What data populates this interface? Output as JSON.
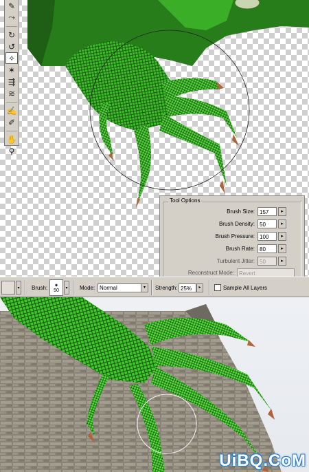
{
  "toolbox": {
    "tools": [
      {
        "icon": "forward-warp-icon",
        "glyph": "✎",
        "active": false
      },
      {
        "icon": "reconstruct-icon",
        "glyph": "⤳",
        "active": false
      },
      {
        "icon": "twirl-clockwise-icon",
        "glyph": "↻",
        "active": false
      },
      {
        "icon": "twirl-counterclockwise-icon",
        "glyph": "↺",
        "active": false
      },
      {
        "icon": "pucker-icon",
        "glyph": "✧",
        "active": true
      },
      {
        "icon": "bloat-icon",
        "glyph": "✶",
        "active": false
      },
      {
        "icon": "shift-pixels-icon",
        "glyph": "⇶",
        "active": false
      },
      {
        "icon": "reflection-icon",
        "glyph": "≋",
        "active": false
      },
      {
        "icon": "freeze-mask-icon",
        "glyph": "✍",
        "active": false
      },
      {
        "icon": "thaw-mask-icon",
        "glyph": "✐",
        "active": false
      },
      {
        "icon": "hand-icon",
        "glyph": "✋",
        "active": false
      },
      {
        "icon": "zoom-icon",
        "glyph": "⚲",
        "active": false
      }
    ]
  },
  "tool_options": {
    "legend": "Tool Options",
    "rows": [
      {
        "label": "Brush Size:",
        "value": "157"
      },
      {
        "label": "Brush Density:",
        "value": "50"
      },
      {
        "label": "Brush Pressure:",
        "value": "100"
      },
      {
        "label": "Brush Rate:",
        "value": "80"
      }
    ],
    "turbulent": {
      "label": "Turbulent Jitter:",
      "value": "50"
    },
    "reconstruct": {
      "label": "Reconstruct Mode:",
      "value": "Revert"
    }
  },
  "options_bar": {
    "brush_label": "Brush:",
    "brush_size": "50",
    "mode_label": "Mode:",
    "mode_value": "Normal",
    "strength_label": "Strength:",
    "strength_value": "25%",
    "sample_all_layers_label": "Sample All Layers",
    "sample_all_layers_checked": false
  },
  "watermark": "UiBQ.CoM",
  "colors": {
    "panel": "#d4d0c8",
    "lizard_green": "#3fbf2a",
    "lizard_dark": "#1b5e14",
    "claw": "#b0643c",
    "watermark_outline": "#2a7fd1"
  }
}
